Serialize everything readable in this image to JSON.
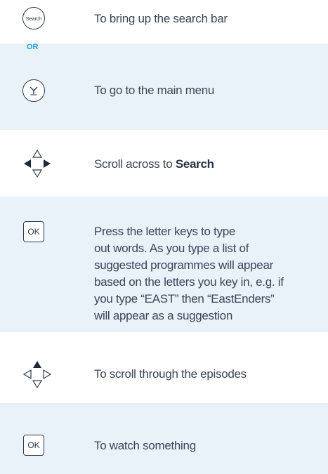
{
  "rows": [
    {
      "key": "Search",
      "text": "To bring up the search bar"
    },
    {
      "key": "OR"
    },
    {
      "key": "home-button",
      "text": "To go to the main menu"
    },
    {
      "key": "nav-left-right",
      "text_prefix": "Scroll across to ",
      "text_bold": "Search"
    },
    {
      "key": "OK",
      "text_lines": [
        "Press the letter keys to type",
        "out words. As you type a list of",
        "suggested programmes will appear",
        "based on the letters you key in, e.g. if",
        "you type “EAST” then “EastEnders”",
        "will appear as a suggestion"
      ]
    },
    {
      "key": "nav-up-down",
      "text": "To scroll through the episodes"
    },
    {
      "key": "OK",
      "text": "To watch something"
    }
  ],
  "colors": {
    "band": "#e9f1f9",
    "white": "#ffffff",
    "or": "#1e9bd7",
    "text": "#3b4657"
  }
}
